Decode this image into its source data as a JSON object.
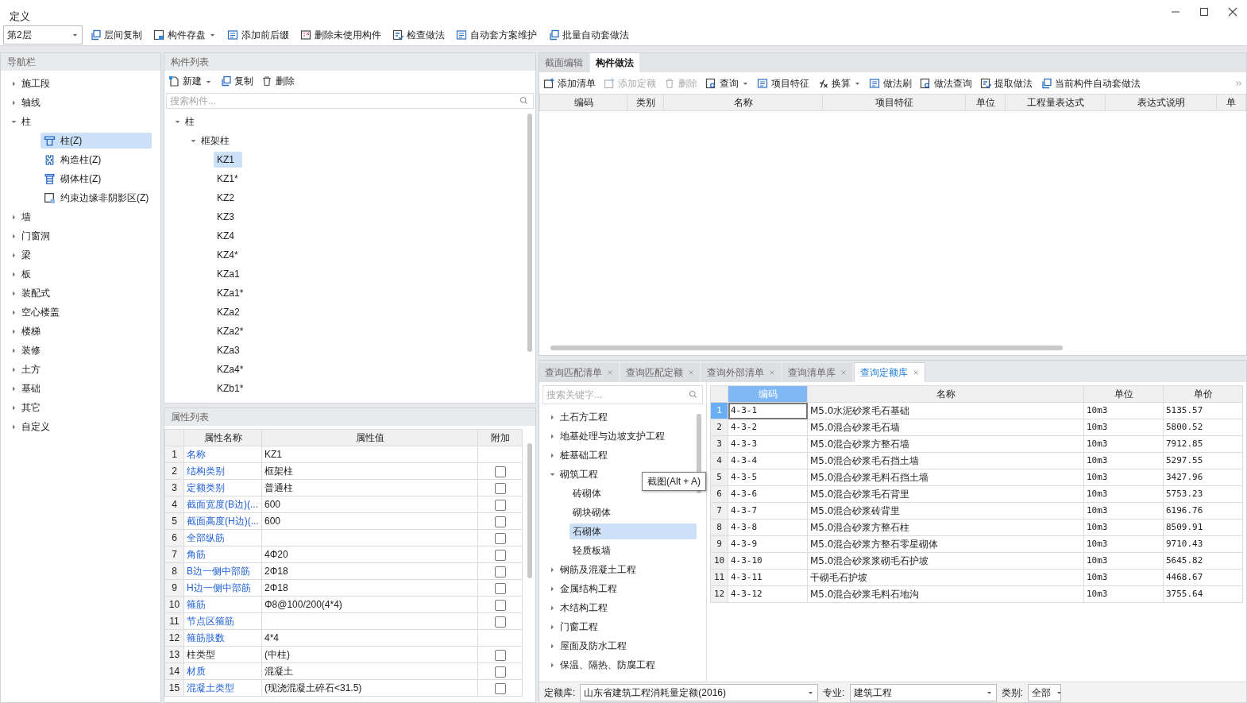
{
  "window": {
    "title": "定义"
  },
  "toolbar": {
    "floor": "第2层",
    "buttons": [
      {
        "label": "层间复制",
        "kind": "copy",
        "dropdown": false
      },
      {
        "label": "构件存盘",
        "kind": "save",
        "dropdown": true
      },
      {
        "label": "添加前后缀",
        "kind": "list",
        "dropdown": false
      },
      {
        "label": "删除未使用构件",
        "kind": "deletelist",
        "dropdown": false
      },
      {
        "label": "检查做法",
        "kind": "check",
        "dropdown": false
      },
      {
        "label": "自动套方案维护",
        "kind": "list",
        "dropdown": false
      },
      {
        "label": "批量自动套做法",
        "kind": "copy",
        "dropdown": false
      }
    ]
  },
  "nav": {
    "title": "导航栏",
    "items": [
      {
        "label": "施工段",
        "expanded": false
      },
      {
        "label": "轴线",
        "expanded": false
      },
      {
        "label": "柱",
        "expanded": true,
        "children": [
          {
            "label": "柱(Z)",
            "kind": "column",
            "selected": true
          },
          {
            "label": "构造柱(Z)",
            "kind": "constructional",
            "selected": false
          },
          {
            "label": "砌体柱(Z)",
            "kind": "masonry",
            "selected": false
          },
          {
            "label": "约束边缘非阴影区(Z)",
            "kind": "boundary",
            "selected": false
          }
        ]
      },
      {
        "label": "墙",
        "expanded": false
      },
      {
        "label": "门窗洞",
        "expanded": false
      },
      {
        "label": "梁",
        "expanded": false
      },
      {
        "label": "板",
        "expanded": false
      },
      {
        "label": "装配式",
        "expanded": false
      },
      {
        "label": "空心楼盖",
        "expanded": false
      },
      {
        "label": "楼梯",
        "expanded": false
      },
      {
        "label": "装修",
        "expanded": false
      },
      {
        "label": "土方",
        "expanded": false
      },
      {
        "label": "基础",
        "expanded": false
      },
      {
        "label": "其它",
        "expanded": false
      },
      {
        "label": "自定义",
        "expanded": false
      }
    ]
  },
  "components": {
    "title": "构件列表",
    "buttons": [
      {
        "label": "新建",
        "kind": "new",
        "dropdown": true
      },
      {
        "label": "复制",
        "kind": "copy",
        "dropdown": false
      },
      {
        "label": "删除",
        "kind": "trash",
        "dropdown": false
      }
    ],
    "search": {
      "placeholder": "搜索构件..."
    },
    "tree": [
      {
        "label": "柱",
        "expanded": true,
        "children": [
          {
            "label": "框架柱",
            "expanded": true,
            "children": [
              {
                "label": "KZ1",
                "selected": true
              },
              {
                "label": "KZ1*",
                "selected": false
              },
              {
                "label": "KZ2",
                "selected": false
              },
              {
                "label": "KZ3",
                "selected": false
              },
              {
                "label": "KZ4",
                "selected": false
              },
              {
                "label": "KZ4*",
                "selected": false
              },
              {
                "label": "KZa1",
                "selected": false
              },
              {
                "label": "KZa1*",
                "selected": false
              },
              {
                "label": "KZa2",
                "selected": false
              },
              {
                "label": "KZa2*",
                "selected": false
              },
              {
                "label": "KZa3",
                "selected": false
              },
              {
                "label": "KZa4*",
                "selected": false
              },
              {
                "label": "KZb1*",
                "selected": false
              }
            ]
          }
        ]
      }
    ]
  },
  "properties": {
    "title": "属性列表",
    "columns": [
      "属性名称",
      "属性值",
      "附加"
    ],
    "rows": [
      {
        "num": "1",
        "name": "名称",
        "value": "KZ1",
        "public": true
      },
      {
        "num": "2",
        "name": "结构类别",
        "value": "框架柱",
        "public": true,
        "checked": false
      },
      {
        "num": "3",
        "name": "定额类别",
        "value": "普通柱",
        "public": true,
        "checked": false
      },
      {
        "num": "4",
        "name": "截面宽度(B边)(...",
        "value": "600",
        "public": true,
        "checked": false
      },
      {
        "num": "5",
        "name": "截面高度(H边)(...",
        "value": "600",
        "public": true,
        "checked": false
      },
      {
        "num": "6",
        "name": "全部纵筋",
        "public": true,
        "checked": false
      },
      {
        "num": "7",
        "name": "角筋",
        "value": "4Φ20",
        "public": true,
        "checked": false
      },
      {
        "num": "8",
        "name": "B边一侧中部筋",
        "value": "2Φ18",
        "public": true,
        "checked": false
      },
      {
        "num": "9",
        "name": "H边一侧中部筋",
        "value": "2Φ18",
        "public": true,
        "checked": false
      },
      {
        "num": "10",
        "name": "箍筋",
        "value": "Φ8@100/200(4*4)",
        "public": true,
        "checked": false
      },
      {
        "num": "11",
        "name": "节点区箍筋",
        "public": true,
        "checked": false
      },
      {
        "num": "12",
        "name": "箍筋肢数",
        "value": "4*4",
        "public": true
      },
      {
        "num": "13",
        "name": "柱类型",
        "value": "(中柱)",
        "public": false,
        "checked": false
      },
      {
        "num": "14",
        "name": "材质",
        "value": "混凝土",
        "public": true,
        "checked": false
      },
      {
        "num": "15",
        "name": "混凝土类型",
        "value": "(现浇混凝土碎石<31.5)",
        "public": true,
        "checked": false
      }
    ]
  },
  "method": {
    "tabs": [
      {
        "label": "截面编辑",
        "selected": false
      },
      {
        "label": "构件做法",
        "selected": true
      }
    ],
    "buttons": [
      {
        "label": "添加清单",
        "kind": "add",
        "dropdown": false,
        "disabled": false
      },
      {
        "label": "添加定额",
        "kind": "add",
        "dropdown": false,
        "disabled": true
      },
      {
        "label": "删除",
        "kind": "trash",
        "dropdown": false,
        "disabled": true
      },
      {
        "label": "查询",
        "kind": "searchdoc",
        "dropdown": true,
        "disabled": false
      },
      {
        "label": "项目特征",
        "kind": "list",
        "dropdown": false,
        "disabled": false
      },
      {
        "label": "换算",
        "kind": "formula",
        "dropdown": true,
        "disabled": false
      },
      {
        "label": "做法刷",
        "kind": "list",
        "dropdown": false,
        "disabled": false
      },
      {
        "label": "做法查询",
        "kind": "searchdoc",
        "dropdown": false,
        "disabled": false
      },
      {
        "label": "提取做法",
        "kind": "check",
        "dropdown": false,
        "disabled": false
      },
      {
        "label": "当前构件自动套做法",
        "kind": "copy",
        "dropdown": false,
        "disabled": false
      }
    ],
    "columns": [
      "编码",
      "类别",
      "名称",
      "项目特征",
      "单位",
      "工程量表达式",
      "表达式说明",
      "单"
    ]
  },
  "query": {
    "tabs": [
      {
        "label": "查询匹配清单",
        "selected": false
      },
      {
        "label": "查询匹配定额",
        "selected": false
      },
      {
        "label": "查询外部清单",
        "selected": false
      },
      {
        "label": "查询清单库",
        "selected": false
      },
      {
        "label": "查询定额库",
        "selected": true
      }
    ],
    "search": {
      "placeholder": "搜索关键字..."
    },
    "tree": [
      {
        "label": "土石方工程",
        "expanded": false
      },
      {
        "label": "地基处理与边坡支护工程",
        "expanded": false
      },
      {
        "label": "桩基础工程",
        "expanded": false
      },
      {
        "label": "砌筑工程",
        "expanded": true,
        "children": [
          {
            "label": "砖砌体",
            "selected": false
          },
          {
            "label": "砌块砌体",
            "selected": false
          },
          {
            "label": "石砌体",
            "selected": true
          },
          {
            "label": "轻质板墙",
            "selected": false
          }
        ]
      },
      {
        "label": "钢筋及混凝土工程",
        "expanded": false
      },
      {
        "label": "金属结构工程",
        "expanded": false
      },
      {
        "label": "木结构工程",
        "expanded": false
      },
      {
        "label": "门窗工程",
        "expanded": false
      },
      {
        "label": "屋面及防水工程",
        "expanded": false
      },
      {
        "label": "保温、隔热、防腐工程",
        "expanded": false
      }
    ],
    "columns": [
      {
        "label": "编码",
        "selected": true
      },
      {
        "label": "名称",
        "selected": false
      },
      {
        "label": "单位",
        "selected": false
      },
      {
        "label": "单价",
        "selected": false
      }
    ],
    "rows": [
      {
        "num": "1",
        "code": "4-3-1",
        "name": "M5.0水泥砂浆毛石基础",
        "unit": "10m3",
        "price": "5135.57",
        "selected": true
      },
      {
        "num": "2",
        "code": "4-3-2",
        "name": "M5.0混合砂浆毛石墙",
        "unit": "10m3",
        "price": "5800.52",
        "selected": false
      },
      {
        "num": "3",
        "code": "4-3-3",
        "name": "M5.0混合砂浆方整石墙",
        "unit": "10m3",
        "price": "7912.85",
        "selected": false
      },
      {
        "num": "4",
        "code": "4-3-4",
        "name": "M5.0混合砂浆毛石挡土墙",
        "unit": "10m3",
        "price": "5297.55",
        "selected": false
      },
      {
        "num": "5",
        "code": "4-3-5",
        "name": "M5.0混合砂浆毛料石挡土墙",
        "unit": "10m3",
        "price": "3427.96",
        "selected": false
      },
      {
        "num": "6",
        "code": "4-3-6",
        "name": "M5.0混合砂浆毛石背里",
        "unit": "10m3",
        "price": "5753.23",
        "selected": false
      },
      {
        "num": "7",
        "code": "4-3-7",
        "name": "M5.0混合砂浆砖背里",
        "unit": "10m3",
        "price": "6196.76",
        "selected": false
      },
      {
        "num": "8",
        "code": "4-3-8",
        "name": "M5.0混合砂浆方整石柱",
        "unit": "10m3",
        "price": "8509.91",
        "selected": false
      },
      {
        "num": "9",
        "code": "4-3-9",
        "name": "M5.0混合砂浆方整石零星砌体",
        "unit": "10m3",
        "price": "9710.43",
        "selected": false
      },
      {
        "num": "10",
        "code": "4-3-10",
        "name": "M5.0混合砂浆浆砌毛石护坡",
        "unit": "10m3",
        "price": "5645.82",
        "selected": false
      },
      {
        "num": "11",
        "code": "4-3-11",
        "name": "干砌毛石护坡",
        "unit": "10m3",
        "price": "4468.67",
        "selected": false
      },
      {
        "num": "12",
        "code": "4-3-12",
        "name": "M5.0混合砂浆毛料石地沟",
        "unit": "10m3",
        "price": "3755.64",
        "selected": false
      }
    ],
    "footer": [
      {
        "label": "定额库:",
        "value": "山东省建筑工程消耗量定额(2016)"
      },
      {
        "label": "专业:",
        "value": "建筑工程"
      },
      {
        "label": "类别:",
        "value": "全部"
      }
    ],
    "tooltip": "截图(Alt + A)"
  }
}
